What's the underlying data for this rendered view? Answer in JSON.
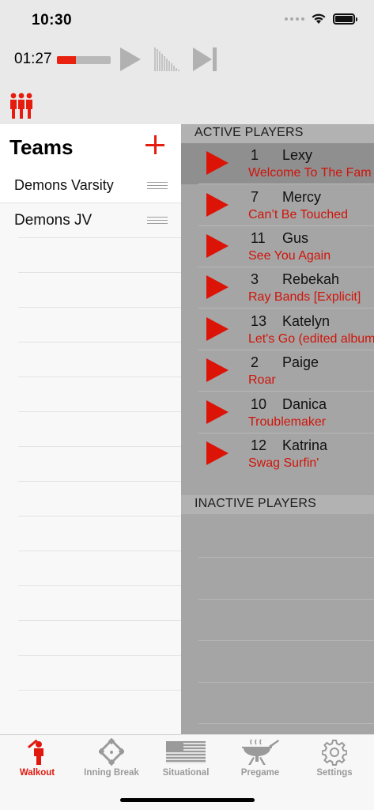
{
  "status_bar": {
    "time": "10:30"
  },
  "player": {
    "elapsed": "01:27",
    "progress": 0.35
  },
  "colors": {
    "accent": "#e61d0e",
    "song_text": "#d0140a",
    "panel_gray": "#a5a5a5"
  },
  "teams": {
    "title": "Teams",
    "items": [
      {
        "name": "Demons Varsity"
      },
      {
        "name": "Demons JV"
      }
    ]
  },
  "players": {
    "active_header": "ACTIVE PLAYERS",
    "inactive_header": "INACTIVE PLAYERS",
    "items": [
      {
        "number": "1",
        "name": "Lexy",
        "song": "Welcome To The Fam"
      },
      {
        "number": "7",
        "name": "Mercy",
        "song": "Can’t Be Touched"
      },
      {
        "number": "11",
        "name": "Gus",
        "song": "See You Again"
      },
      {
        "number": "3",
        "name": "Rebekah",
        "song": "Ray Bands [Explicit]"
      },
      {
        "number": "13",
        "name": "Katelyn",
        "song": "Let's Go (edited album"
      },
      {
        "number": "2",
        "name": "Paige",
        "song": "Roar"
      },
      {
        "number": "10",
        "name": "Danica",
        "song": "Troublemaker"
      },
      {
        "number": "12",
        "name": "Katrina",
        "song": "Swag Surfin'"
      }
    ]
  },
  "tabs": [
    {
      "label": "Walkout",
      "icon": "batter-icon"
    },
    {
      "label": "Inning Break",
      "icon": "baseball-diamond-icon"
    },
    {
      "label": "Situational",
      "icon": "us-flag-icon"
    },
    {
      "label": "Pregame",
      "icon": "grill-icon"
    },
    {
      "label": "Settings",
      "icon": "gear-icon"
    }
  ]
}
